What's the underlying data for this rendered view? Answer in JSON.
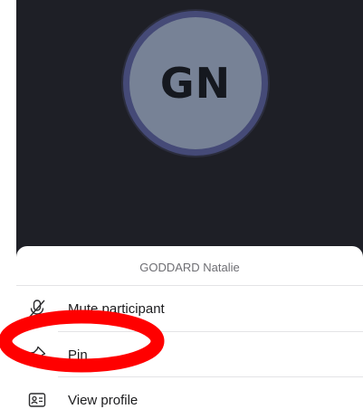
{
  "participant": {
    "initials": "GN",
    "name": "GODDARD Natalie"
  },
  "menu": {
    "items": [
      {
        "label": "Mute participant",
        "icon": "mic-off-icon"
      },
      {
        "label": "Pin",
        "icon": "pin-icon"
      },
      {
        "label": "View profile",
        "icon": "id-card-icon"
      }
    ]
  },
  "colors": {
    "video_background": "#1e1f26",
    "avatar_fill": "#778296",
    "avatar_ring": "#454a77",
    "annotation": "#ff0000"
  }
}
